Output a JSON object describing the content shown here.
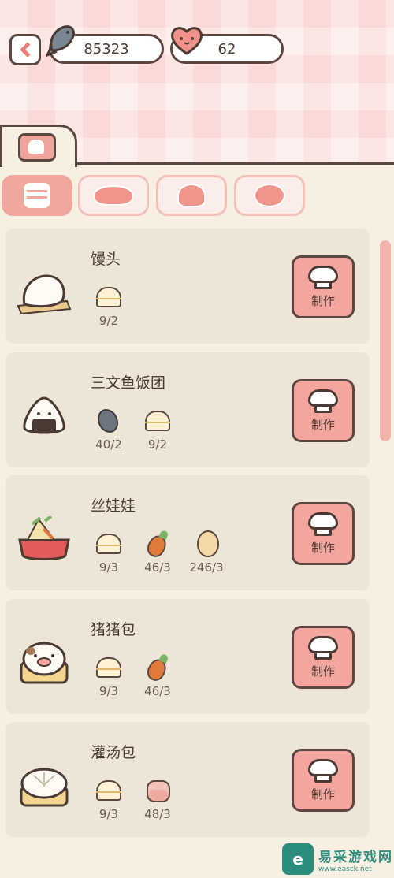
{
  "currency": {
    "coins": "85323",
    "hearts": "62"
  },
  "colors": {
    "accent": "#f4a59d",
    "outline": "#5b4740",
    "header_pink": "#fbd9d6",
    "card_bg": "#ede6d6"
  },
  "category_tabs": [
    {
      "icon": "steamer-tab-icon"
    },
    {
      "icon": "wok-tab-icon"
    },
    {
      "icon": "pot-tab-icon"
    },
    {
      "icon": "frying-pan-tab-icon"
    }
  ],
  "make_label": "制作",
  "recipes": [
    {
      "name": "馒头",
      "ingredients": [
        {
          "icon": "steamer-icon",
          "qty": "9/2"
        }
      ]
    },
    {
      "name": "三文鱼饭团",
      "ingredients": [
        {
          "icon": "fish-icon",
          "qty": "40/2"
        },
        {
          "icon": "steamer-icon",
          "qty": "9/2"
        }
      ]
    },
    {
      "name": "丝娃娃",
      "ingredients": [
        {
          "icon": "steamer-icon",
          "qty": "9/3"
        },
        {
          "icon": "carrot-icon",
          "qty": "46/3"
        },
        {
          "icon": "egg-icon",
          "qty": "246/3"
        }
      ]
    },
    {
      "name": "猪猪包",
      "ingredients": [
        {
          "icon": "steamer-icon",
          "qty": "9/3"
        },
        {
          "icon": "carrot-icon",
          "qty": "46/3"
        }
      ]
    },
    {
      "name": "灌汤包",
      "ingredients": [
        {
          "icon": "steamer-icon",
          "qty": "9/3"
        },
        {
          "icon": "macaron-icon",
          "qty": "48/3"
        }
      ]
    }
  ],
  "watermark": {
    "badge": "e",
    "title": "易采游戏网",
    "url": "www.easck.net"
  }
}
